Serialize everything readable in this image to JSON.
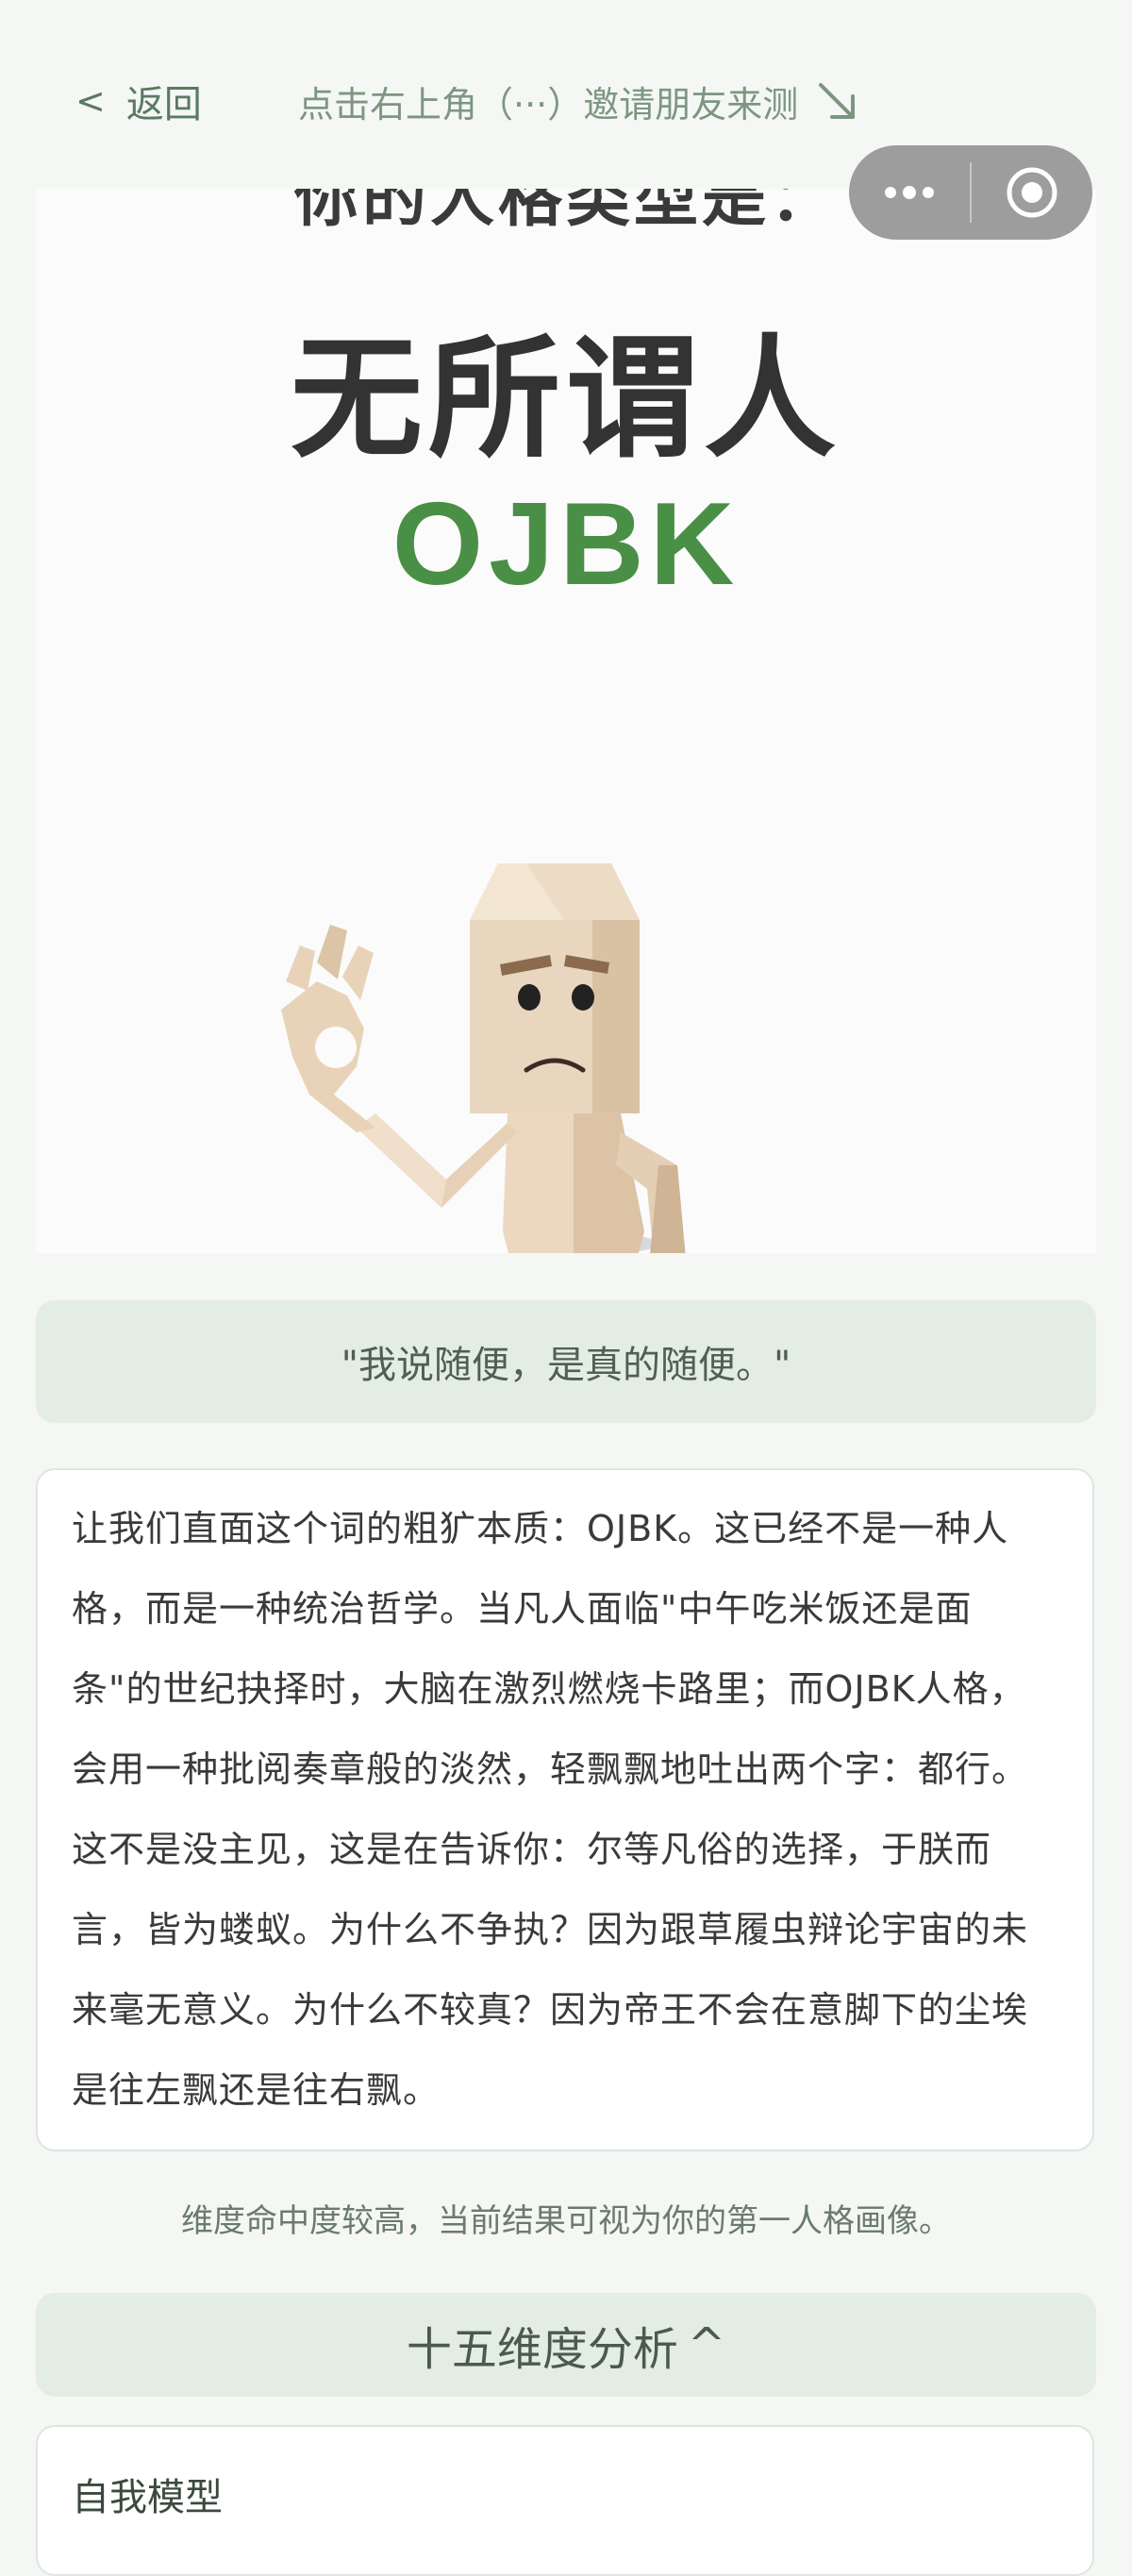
{
  "nav": {
    "back_chevron": "<",
    "back_label": "返回",
    "hint": "点击右上角（···）邀请朋友来测",
    "arrow_icon": "arrow-down-right-icon"
  },
  "capsule": {
    "more_icon": "more-dots-icon",
    "close_icon": "target-close-icon"
  },
  "result": {
    "label": "你的人格类型是：",
    "title": "无所谓人",
    "code": "OJBK",
    "figure_icon": "ok-gesture-figure"
  },
  "quote": "\"我说随便，是真的随便。\"",
  "description": "让我们直面这个词的粗犷本质：OJBK。这已经不是一种人格，而是一种统治哲学。当凡人面临\"中午吃米饭还是面条\"的世纪抉择时，大脑在激烈燃烧卡路里；而OJBK人格，会用一种批阅奏章般的淡然，轻飘飘地吐出两个字：都行。这不是没主见，这是在告诉你：尔等凡俗的选择，于朕而言，皆为蝼蚁。为什么不争执？因为跟草履虫辩论宇宙的未来毫无意义。为什么不较真？因为帝王不会在意脚下的尘埃是往左飘还是往右飘。",
  "note": "维度命中度较高，当前结果可视为你的第一人格画像。",
  "section": {
    "title": "十五维度分析",
    "toggle": "^"
  },
  "dimensions": {
    "first_label": "自我模型"
  },
  "colors": {
    "accent_green": "#4a8f46",
    "soft_green_bg": "#e3ede3",
    "page_bg": "#f4f7f4"
  }
}
